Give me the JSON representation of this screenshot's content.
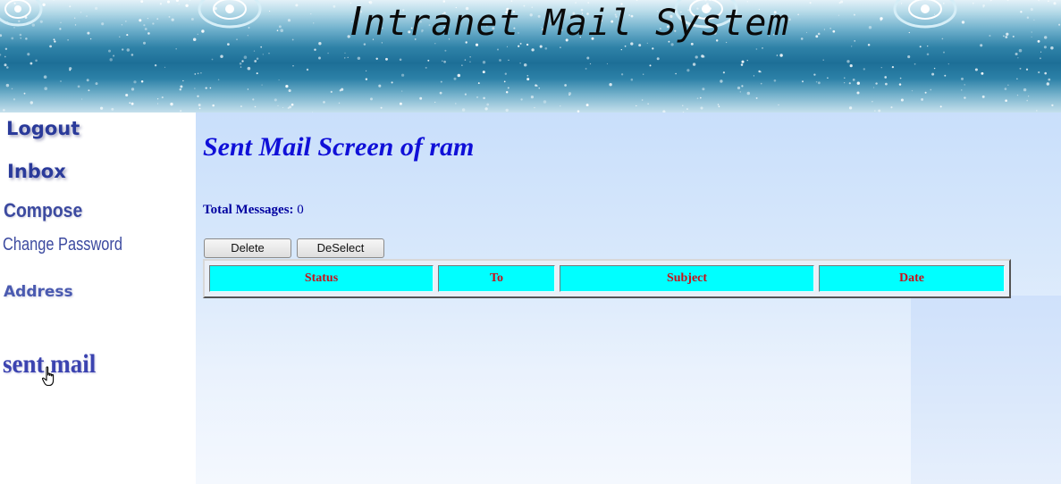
{
  "banner": {
    "title_initial": "I",
    "title_rest": "ntranet Mail System"
  },
  "sidebar": {
    "items": [
      {
        "label": "Logout"
      },
      {
        "label": "Inbox"
      },
      {
        "label": "Compose"
      },
      {
        "label": "Change Password"
      },
      {
        "label": "Address"
      },
      {
        "label": "sent mail"
      }
    ]
  },
  "main": {
    "heading": "Sent Mail Screen of ram",
    "total_label": "Total Messages:",
    "total_value": "0",
    "buttons": {
      "delete": "Delete",
      "deselect": "DeSelect"
    },
    "table": {
      "columns": [
        "Status",
        "To",
        "Subject",
        "Date"
      ],
      "rows": []
    }
  },
  "colors": {
    "heading": "#1010d8",
    "header_cell_bg": "#00ffff",
    "header_cell_text": "#c8101a",
    "content_bg": "#c9dffb",
    "nav_text": "#2b2f9e"
  },
  "icons": {
    "cursor": "hand-pointer-icon",
    "banner_ornament": "snowflake-ornament-icon"
  }
}
